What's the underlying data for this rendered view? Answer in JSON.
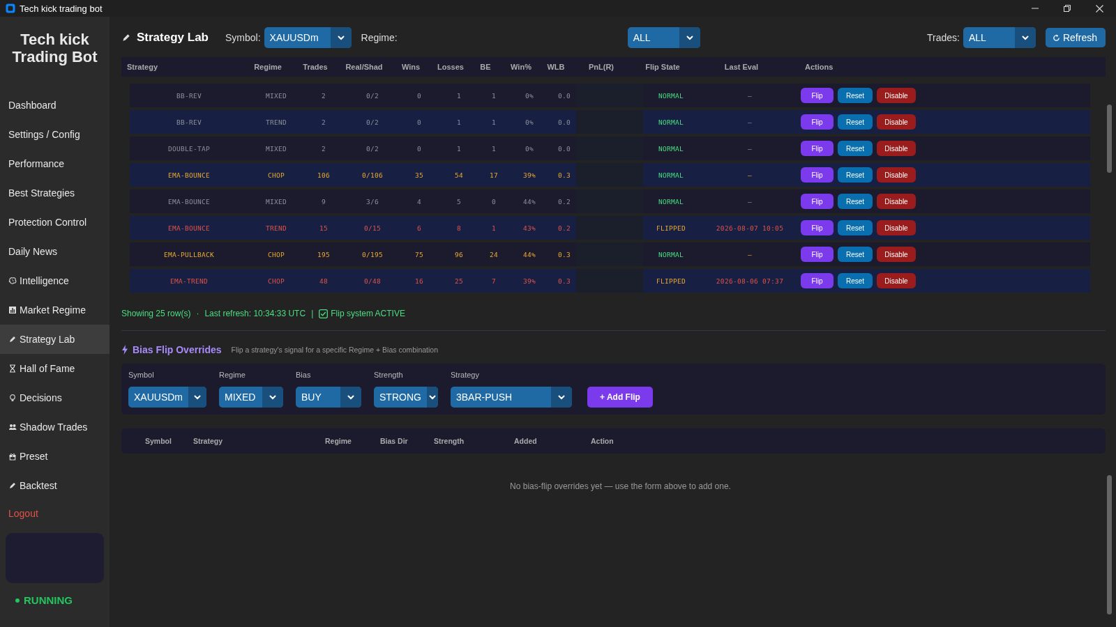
{
  "window": {
    "title": "Tech kick trading bot"
  },
  "sidebar": {
    "title": "Tech kick Trading Bot",
    "items": [
      {
        "label": "Dashboard",
        "selected": false
      },
      {
        "label": "Settings / Config",
        "selected": false
      },
      {
        "label": "Performance",
        "selected": false
      },
      {
        "label": "Best Strategies",
        "selected": false
      },
      {
        "label": "Protection Control",
        "selected": false
      },
      {
        "label": "Daily News",
        "selected": false
      },
      {
        "label": "Intelligence",
        "selected": false
      },
      {
        "label": "Market Regime",
        "selected": false
      },
      {
        "label": "Strategy Lab",
        "selected": true
      },
      {
        "label": "Hall of Fame",
        "selected": false
      },
      {
        "label": "Decisions",
        "selected": false
      },
      {
        "label": "Shadow Trades",
        "selected": false
      },
      {
        "label": "Preset",
        "selected": false
      },
      {
        "label": "Backtest",
        "selected": false
      }
    ],
    "logout": "Logout",
    "status": "RUNNING"
  },
  "header": {
    "title": "Strategy Lab",
    "filters": [
      {
        "label": "Symbol:",
        "value": "XAUUSDm"
      },
      {
        "label": "Regime:",
        "value": "ALL"
      },
      {
        "label": "Trades:",
        "value": "ALL"
      }
    ],
    "refresh": "Refresh"
  },
  "table": {
    "columns": [
      "Strategy",
      "Regime",
      "Trades",
      "Real/Shad",
      "Wins",
      "Losses",
      "BE",
      "Win%",
      "WLB",
      "PnL(R)",
      "Flip State",
      "Last Eval",
      "Actions"
    ],
    "rows": [
      {
        "strategy": "BB-REV",
        "regime": "MIXED",
        "trades": "2",
        "real_shad": "0/2",
        "wins": "0",
        "losses": "1",
        "be": "1",
        "win_pct": "0%",
        "wlb": "0.0",
        "kind": "neutral",
        "flip_state": "NORMAL",
        "flipped": false,
        "last_eval": "–",
        "actions": [
          "Flip",
          "Reset",
          "Disable"
        ]
      },
      {
        "strategy": "BB-REV",
        "regime": "TREND",
        "trades": "2",
        "real_shad": "0/2",
        "wins": "0",
        "losses": "1",
        "be": "1",
        "win_pct": "0%",
        "wlb": "0.0",
        "kind": "neutral",
        "flip_state": "NORMAL",
        "flipped": false,
        "last_eval": "–",
        "actions": [
          "Flip",
          "Reset",
          "Disable"
        ]
      },
      {
        "strategy": "DOUBLE-TAP",
        "regime": "MIXED",
        "trades": "2",
        "real_shad": "0/2",
        "wins": "0",
        "losses": "1",
        "be": "1",
        "win_pct": "0%",
        "wlb": "0.0",
        "kind": "neutral",
        "flip_state": "NORMAL",
        "flipped": false,
        "last_eval": "–",
        "actions": [
          "Flip",
          "Reset",
          "Disable"
        ]
      },
      {
        "strategy": "EMA-BOUNCE",
        "regime": "CHOP",
        "trades": "106",
        "real_shad": "0/106",
        "wins": "35",
        "losses": "54",
        "be": "17",
        "win_pct": "39%",
        "wlb": "0.3",
        "kind": "gold",
        "flip_state": "NORMAL",
        "flipped": false,
        "last_eval": "–",
        "actions": [
          "Flip",
          "Reset",
          "Disable"
        ]
      },
      {
        "strategy": "EMA-BOUNCE",
        "regime": "MIXED",
        "trades": "9",
        "real_shad": "3/6",
        "wins": "4",
        "losses": "5",
        "be": "0",
        "win_pct": "44%",
        "wlb": "0.2",
        "kind": "neutral",
        "flip_state": "NORMAL",
        "flipped": false,
        "last_eval": "–",
        "actions": [
          "Flip",
          "Reset",
          "Disable"
        ]
      },
      {
        "strategy": "EMA-BOUNCE",
        "regime": "TREND",
        "trades": "15",
        "real_shad": "0/15",
        "wins": "6",
        "losses": "8",
        "be": "1",
        "win_pct": "43%",
        "wlb": "0.2",
        "kind": "red",
        "flip_state": "FLIPPED",
        "flipped": true,
        "last_eval": "2026-08-07 10:05",
        "actions": [
          "Flip",
          "Reset",
          "Disable"
        ]
      },
      {
        "strategy": "EMA-PULLBACK",
        "regime": "CHOP",
        "trades": "195",
        "real_shad": "0/195",
        "wins": "75",
        "losses": "96",
        "be": "24",
        "win_pct": "44%",
        "wlb": "0.3",
        "kind": "gold",
        "flip_state": "NORMAL",
        "flipped": false,
        "last_eval": "–",
        "actions": [
          "Flip",
          "Reset",
          "Disable"
        ]
      },
      {
        "strategy": "EMA-TREND",
        "regime": "CHOP",
        "trades": "48",
        "real_shad": "0/48",
        "wins": "16",
        "losses": "25",
        "be": "7",
        "win_pct": "39%",
        "wlb": "0.3",
        "kind": "red",
        "flip_state": "FLIPPED",
        "flipped": true,
        "last_eval": "2026-08-06 07:37",
        "actions": [
          "Flip",
          "Reset",
          "Disable"
        ]
      }
    ]
  },
  "status": {
    "rows": "Showing 25 row(s)",
    "separator": "·",
    "refresh": "Last refresh: 10:34:33 UTC",
    "divider": "|",
    "flip_active": true,
    "flip_label": "Flip system ACTIVE"
  },
  "bias": {
    "title": "Bias Flip Overrides",
    "subtitle": "Flip a strategy's signal for a specific Regime + Bias combination",
    "fields": [
      {
        "label": "Symbol",
        "value": "XAUUSDm"
      },
      {
        "label": "Regime",
        "value": "MIXED"
      },
      {
        "label": "Bias",
        "value": "BUY"
      },
      {
        "label": "Strength",
        "value": "STRONG"
      },
      {
        "label": "Strategy",
        "value": "3BAR-PUSH"
      }
    ],
    "add_button": "+ Add Flip",
    "columns": [
      "Symbol",
      "Strategy",
      "Regime",
      "Bias Dir",
      "Strength",
      "Added",
      "Action"
    ],
    "empty_message": "No bias-flip overrides yet — use the form above to add one."
  }
}
